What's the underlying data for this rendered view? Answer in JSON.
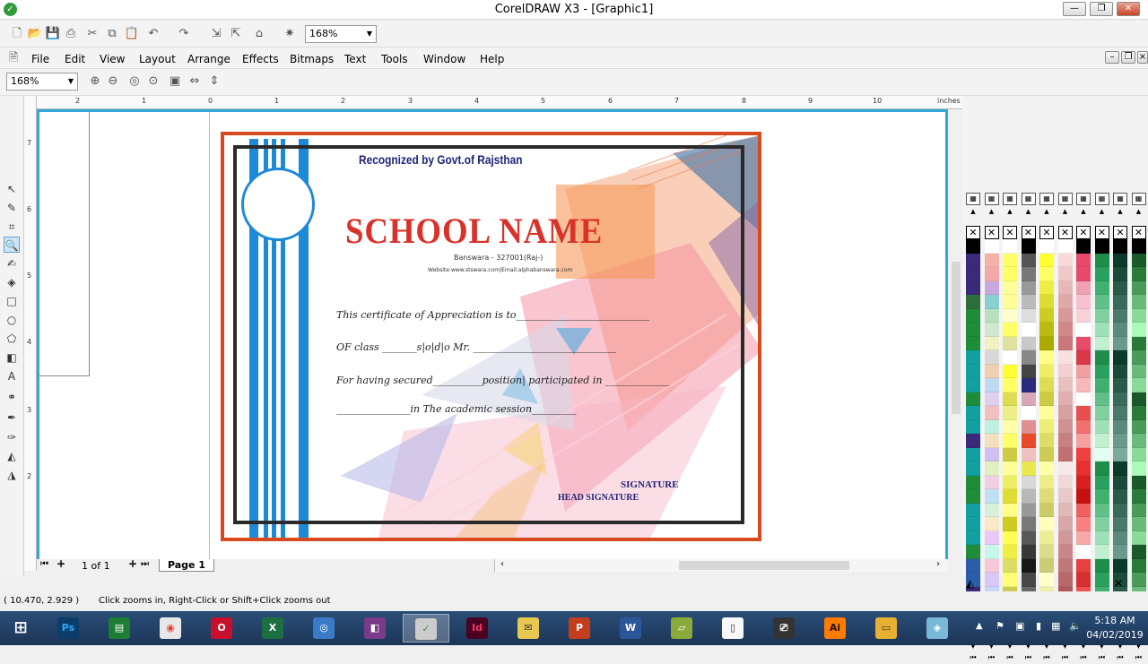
{
  "window": {
    "title": "CorelDRAW X3 - [Graphic1]",
    "minimize": "—",
    "restore": "❐",
    "close": "✕"
  },
  "toolbar": {
    "zoom_value": "168%"
  },
  "menu": [
    "File",
    "Edit",
    "View",
    "Layout",
    "Arrange",
    "Effects",
    "Bitmaps",
    "Text",
    "Tools",
    "Window",
    "Help"
  ],
  "property_bar": {
    "zoom_value": "168%"
  },
  "ruler": {
    "unit": "inches",
    "top_ticks": [
      "2",
      "1",
      "0",
      "1",
      "2",
      "3",
      "4",
      "5",
      "6",
      "7",
      "8",
      "9",
      "10"
    ],
    "left_ticks": [
      "7",
      "6",
      "5",
      "4",
      "3",
      "2"
    ]
  },
  "certificate": {
    "recognition": "Recognized by Govt.of Rajsthan",
    "school_name": "SCHOOL NAME",
    "address": "Banswara - 327001(Raj-)",
    "website": "Website:www.stswara.com|Email:alphabanswara.com",
    "line1": "This certificate of Appreciation is to___________________________",
    "line2": "OF class _______s|o|d|o Mr. _____________________________",
    "line3": "For having secured__________position| participated in _____________",
    "line4": "_______________in The academic session_________",
    "signature": "SIGNATURE",
    "head_signature": "HEAD SIGNATURE"
  },
  "page_nav": {
    "count": "1 of 1",
    "tab": "Page 1"
  },
  "status": {
    "coords": "( 10.470, 2.929 )",
    "hint": "Click zooms in, Right-Click or Shift+Click zooms out"
  },
  "taskbar": {
    "apps": [
      "Ps",
      "Store",
      "Chrome",
      "Opera",
      "Excel",
      "Camera",
      "WinRAR",
      "CorelDRAW",
      "Id",
      "Messenger",
      "PowerPoint",
      "Word",
      "Notepad",
      "File",
      "Camcorder",
      "Ai",
      "Explorer",
      "Notes"
    ],
    "time": "5:18 AM",
    "date": "04/02/2019"
  },
  "colors": {
    "accent": "#33a8d8",
    "cert_border": "#d8491e",
    "school_red": "#d8322a",
    "navy": "#22247a"
  }
}
